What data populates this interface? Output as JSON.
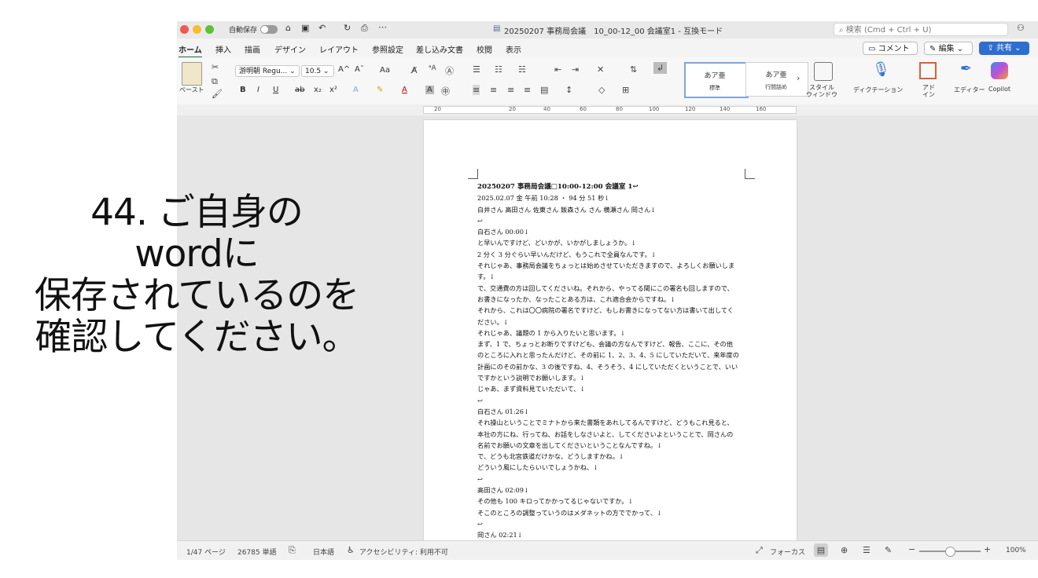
{
  "window": {
    "autosave_label": "自動保存",
    "title": "20250207 事務局会議　10_00-12_00 会議室1 - 互換モード",
    "search_placeholder": "検索 (Cmd + Ctrl + U)"
  },
  "tabs": [
    "ホーム",
    "挿入",
    "描画",
    "デザイン",
    "レイアウト",
    "参照設定",
    "差し込み文書",
    "校閲",
    "表示"
  ],
  "actions": {
    "comment": "コメント",
    "edit": "編集",
    "share": "共有"
  },
  "ribbon": {
    "paste": "ペースト",
    "font_name": "游明朝 Regu...",
    "font_size": "10.5",
    "font_size_up": "A^",
    "font_size_down": "Aˇ",
    "change_case": "Aa",
    "style_preview_1": "あア亜",
    "style_label_1": "標準",
    "style_preview_2": "あア亜",
    "style_label_2": "行間詰め",
    "styles_pane": "スタイル\nウィンドウ",
    "dictation": "ディクテーション",
    "addins": "アド\nイン",
    "editor": "エディター",
    "copilot": "Copilot"
  },
  "ruler": {
    "numbers": [
      "20",
      "20",
      "40",
      "60",
      "80",
      "100",
      "120",
      "140",
      "160"
    ]
  },
  "document": {
    "lines": [
      {
        "t": "20250207 事務局会議□10:00-12:00 会議室 1↩",
        "bold": true
      },
      {
        "t": "2025.02.07 金 午前 10:28 ・ 94 分 51 秒↓"
      },
      {
        "t": "白井さん 高田さん 佐東さん 飯森さん さん 横瀬さん 岡さん↓"
      },
      {
        "t": "↩"
      },
      {
        "t": "白石さん 00:00↓"
      },
      {
        "t": "と早いんですけど、どいかが、いかがしましょうか。↓"
      },
      {
        "t": "2 分く 3 分ぐらい早いんだけど、もうこれで全員なんです。↓"
      },
      {
        "t": "それじゃあ、事務局会議をちょっとは始めさせていただきますので、よろしくお願いしま"
      },
      {
        "t": "す。↓"
      },
      {
        "t": "で、交通費の方は回してくださいね。それから、やってる間にこの署名も回しますので、"
      },
      {
        "t": "お書きになったか、なったことある方は、これ適合会からですね。↓"
      },
      {
        "t": "それから、これは〇〇病院の署名ですけど、もしお書きになってない方は書いて出してく"
      },
      {
        "t": "ださい。↓"
      },
      {
        "t": "それじゃあ、議題の 1 から入りたいと思います。↓"
      },
      {
        "t": "まず、1 で、ちょっとお断りですけども、会議の方なんですけど、報告、ここに、その他"
      },
      {
        "t": "のところに入れと思ったんだけど、その前に 1、2、3、4、5 にしていただいて、来年度の"
      },
      {
        "t": "計画にのその前かな、3 の後ですね、4、そうそう、4 にしていただくということで、いい"
      },
      {
        "t": "ですかという説明でお願いします。↓"
      },
      {
        "t": "じゃあ、まず資料見ていただいて、↓"
      },
      {
        "t": "↩"
      },
      {
        "t": "白石さん 01:26↓"
      },
      {
        "t": "それ操山ということでミナトから来た書類をあれしてるんですけど、どうもこれ見ると、"
      },
      {
        "t": "本社の方にね、行ってね、お話をしなさいよと、してくださいよということで、岡さんの"
      },
      {
        "t": "名前でお願いの文章を出してくださいということなんですね。↓"
      },
      {
        "t": "で、どうも北宮鉄道だけかな、どうしますかね。↓"
      },
      {
        "t": "どういう風にしたらいいでしょうかね、↓"
      },
      {
        "t": "↩"
      },
      {
        "t": "高田さん 02:09↓"
      },
      {
        "t": "その他も 100 キロってかかってるじゃないですか。↓"
      },
      {
        "t": "そこのところの調整っていうのはメダネットの方ででかって、↓"
      },
      {
        "t": "↩"
      },
      {
        "t": "岡さん 02:21↓"
      }
    ]
  },
  "status": {
    "page": "1/47 ページ",
    "words": "26785 単語",
    "language": "日本語",
    "accessibility": "アクセシビリティ: 利用不可",
    "focus": "フォーカス",
    "zoom": "100%"
  },
  "overlay": {
    "line1": "44. ご自身の",
    "line2": "wordに",
    "line3": "保存されているのを",
    "line4": "確認してください。"
  },
  "colors": {
    "share": "#2e6fce",
    "tab_underline": "#1f6d3e",
    "close": "#ee5a52",
    "minimize": "#f5bd30",
    "zoom": "#5fc038"
  }
}
